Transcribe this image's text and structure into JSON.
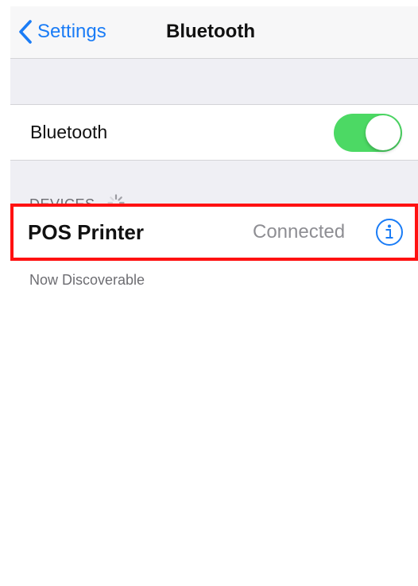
{
  "navbar": {
    "back_label": "Settings",
    "title": "Bluetooth",
    "back_icon": "chevron-left-icon",
    "accent_color": "#1a7cf6"
  },
  "bluetooth_toggle": {
    "label": "Bluetooth",
    "state": "on",
    "on_color": "#4cd964"
  },
  "devices": {
    "header": "DEVICES",
    "loading_icon": "spinner-icon",
    "items": [
      {
        "name": "POS Printer",
        "status": "Connected",
        "info_icon": "info-icon",
        "highlight_color": "#ff1111"
      }
    ]
  },
  "footer": {
    "discoverable_text": "Now Discoverable"
  }
}
